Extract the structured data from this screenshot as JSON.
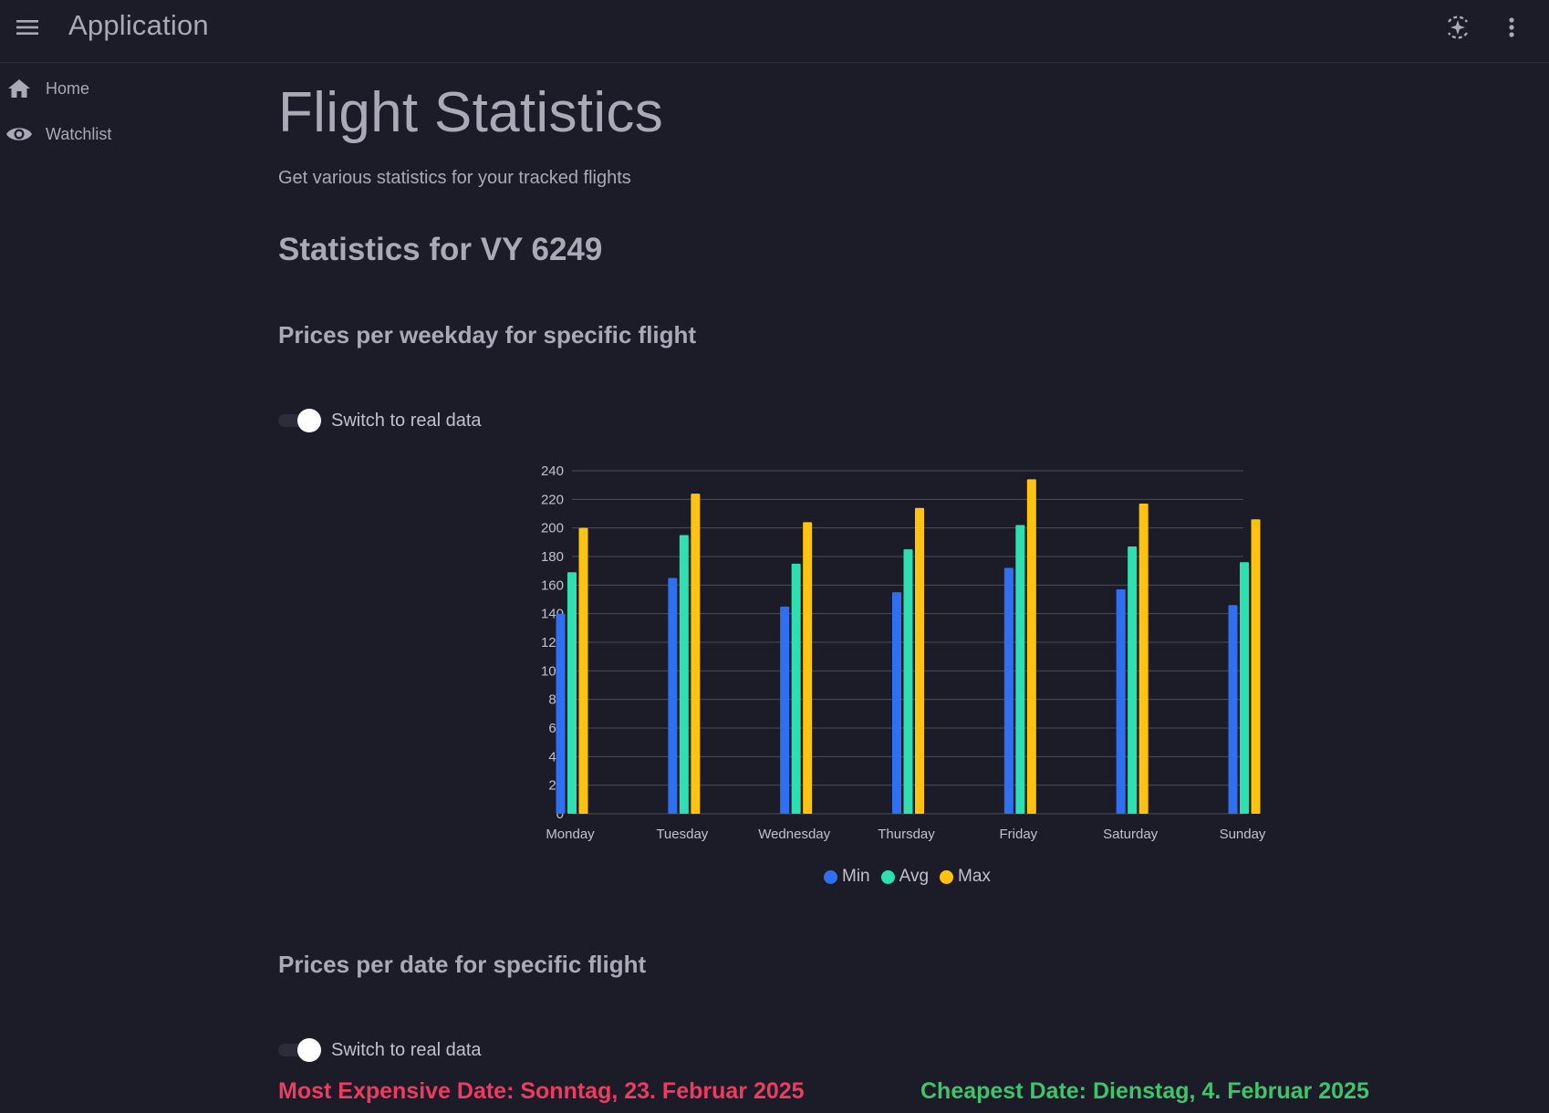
{
  "appbar": {
    "title": "Application",
    "menu_icon": "hamburger-menu-icon",
    "ai_icon": "sparkle-assistant-icon",
    "more_icon": "more-vertical-icon"
  },
  "sidebar": {
    "items": [
      {
        "label": "Home",
        "icon": "home-icon"
      },
      {
        "label": "Watchlist",
        "icon": "eye-icon"
      }
    ]
  },
  "page": {
    "title": "Flight Statistics",
    "subtitle": "Get various statistics for your tracked flights",
    "stats_heading": "Statistics for VY 6249"
  },
  "weekday_section": {
    "heading": "Prices per weekday for specific flight",
    "toggle_label": "Switch to real data",
    "toggle_on": true
  },
  "date_section": {
    "heading": "Prices per date for specific flight",
    "toggle_label": "Switch to real data",
    "toggle_on": true,
    "most_expensive": "Most Expensive Date: Sonntag, 23. Februar 2025",
    "cheapest": "Cheapest Date: Dienstag, 4. Februar 2025"
  },
  "colors": {
    "min": "#2f6ff0",
    "avg": "#2ee0b0",
    "max": "#ffc20e",
    "most_expensive": "#f03a5f",
    "cheapest": "#3fc46a",
    "background": "#1b1c27"
  },
  "chart_data": {
    "type": "bar",
    "title": "",
    "xlabel": "",
    "ylabel": "",
    "categories": [
      "Monday",
      "Tuesday",
      "Wednesday",
      "Thursday",
      "Friday",
      "Saturday",
      "Sunday"
    ],
    "series": [
      {
        "name": "Min",
        "values": [
          140,
          165,
          145,
          155,
          172,
          157,
          146
        ]
      },
      {
        "name": "Avg",
        "values": [
          169,
          195,
          175,
          185,
          202,
          187,
          176
        ]
      },
      {
        "name": "Max",
        "values": [
          200,
          224,
          204,
          214,
          234,
          217,
          206
        ]
      }
    ],
    "ylim": [
      0,
      240
    ],
    "yticks": [
      0,
      20,
      40,
      60,
      80,
      100,
      120,
      140,
      160,
      180,
      200,
      220,
      240
    ],
    "grid": true,
    "legend": "bottom-center"
  }
}
